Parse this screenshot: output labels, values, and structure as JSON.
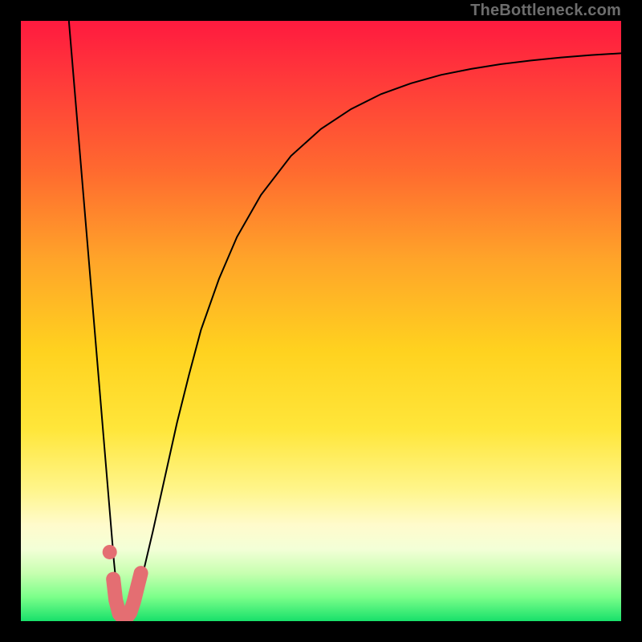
{
  "watermark": "TheBottleneck.com",
  "chart_data": {
    "type": "line",
    "title": "",
    "xlabel": "",
    "ylabel": "",
    "xlim": [
      0,
      100
    ],
    "ylim": [
      0,
      100
    ],
    "background_gradient": {
      "stops": [
        {
          "offset": 0.0,
          "color": "#ff1a3f"
        },
        {
          "offset": 0.1,
          "color": "#ff3a3a"
        },
        {
          "offset": 0.25,
          "color": "#ff6a2f"
        },
        {
          "offset": 0.4,
          "color": "#ffa529"
        },
        {
          "offset": 0.55,
          "color": "#ffd21f"
        },
        {
          "offset": 0.68,
          "color": "#ffe63a"
        },
        {
          "offset": 0.78,
          "color": "#fff58a"
        },
        {
          "offset": 0.84,
          "color": "#fffbcc"
        },
        {
          "offset": 0.88,
          "color": "#f3ffd7"
        },
        {
          "offset": 0.92,
          "color": "#c7ffb0"
        },
        {
          "offset": 0.96,
          "color": "#7bff8a"
        },
        {
          "offset": 1.0,
          "color": "#18e06a"
        }
      ]
    },
    "series": [
      {
        "name": "bottleneck-curve",
        "stroke": "#000000",
        "stroke_width": 2,
        "points": [
          {
            "x": 8.0,
            "y": 100.0
          },
          {
            "x": 9.0,
            "y": 88.0
          },
          {
            "x": 10.0,
            "y": 76.0
          },
          {
            "x": 11.0,
            "y": 64.0
          },
          {
            "x": 12.0,
            "y": 52.0
          },
          {
            "x": 13.0,
            "y": 40.0
          },
          {
            "x": 14.0,
            "y": 28.0
          },
          {
            "x": 15.0,
            "y": 16.0
          },
          {
            "x": 15.5,
            "y": 10.0
          },
          {
            "x": 16.0,
            "y": 5.0
          },
          {
            "x": 16.5,
            "y": 2.0
          },
          {
            "x": 17.0,
            "y": 0.5
          },
          {
            "x": 17.5,
            "y": 0.5
          },
          {
            "x": 18.0,
            "y": 1.0
          },
          {
            "x": 19.0,
            "y": 3.0
          },
          {
            "x": 20.0,
            "y": 6.5
          },
          {
            "x": 22.0,
            "y": 15.0
          },
          {
            "x": 24.0,
            "y": 24.0
          },
          {
            "x": 26.0,
            "y": 33.0
          },
          {
            "x": 28.0,
            "y": 41.0
          },
          {
            "x": 30.0,
            "y": 48.5
          },
          {
            "x": 33.0,
            "y": 57.0
          },
          {
            "x": 36.0,
            "y": 64.0
          },
          {
            "x": 40.0,
            "y": 71.0
          },
          {
            "x": 45.0,
            "y": 77.5
          },
          {
            "x": 50.0,
            "y": 82.0
          },
          {
            "x": 55.0,
            "y": 85.3
          },
          {
            "x": 60.0,
            "y": 87.8
          },
          {
            "x": 65.0,
            "y": 89.6
          },
          {
            "x": 70.0,
            "y": 91.0
          },
          {
            "x": 75.0,
            "y": 92.0
          },
          {
            "x": 80.0,
            "y": 92.8
          },
          {
            "x": 85.0,
            "y": 93.4
          },
          {
            "x": 90.0,
            "y": 93.9
          },
          {
            "x": 95.0,
            "y": 94.3
          },
          {
            "x": 100.0,
            "y": 94.6
          }
        ]
      },
      {
        "name": "optimal-marker",
        "stroke": "#e46e72",
        "stroke_width": 18,
        "linecap": "round",
        "points": [
          {
            "x": 15.4,
            "y": 7.0
          },
          {
            "x": 15.8,
            "y": 3.5
          },
          {
            "x": 16.4,
            "y": 1.2
          },
          {
            "x": 17.0,
            "y": 0.6
          },
          {
            "x": 17.6,
            "y": 0.6
          },
          {
            "x": 18.2,
            "y": 1.4
          },
          {
            "x": 18.8,
            "y": 3.2
          },
          {
            "x": 19.4,
            "y": 5.6
          },
          {
            "x": 20.0,
            "y": 8.0
          }
        ]
      },
      {
        "name": "optimal-marker-dot",
        "type": "scatter",
        "fill": "#e46e72",
        "radius": 9,
        "points": [
          {
            "x": 14.8,
            "y": 11.5
          }
        ]
      }
    ]
  }
}
